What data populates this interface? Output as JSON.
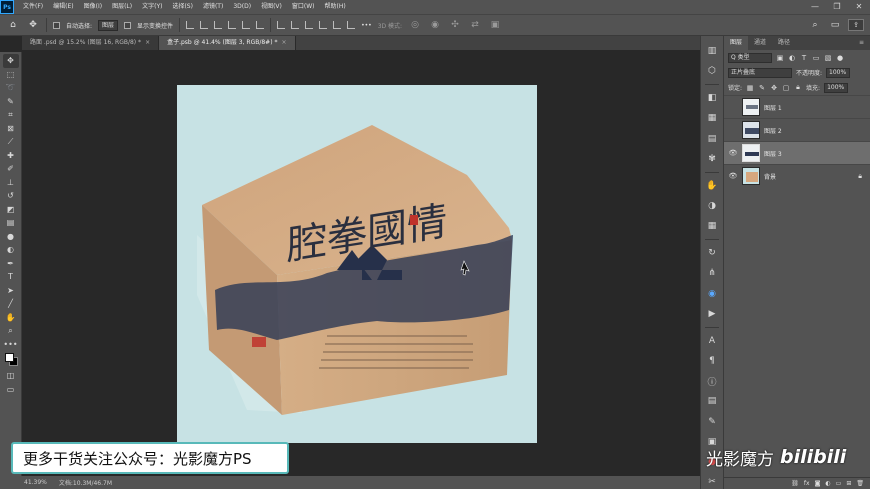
{
  "app": {
    "logo": "Ps"
  },
  "menubar": {
    "items": [
      "文件(F)",
      "编辑(E)",
      "图像(I)",
      "图层(L)",
      "文字(Y)",
      "选择(S)",
      "滤镜(T)",
      "3D(D)",
      "视图(V)",
      "窗口(W)",
      "帮助(H)"
    ],
    "window_controls": [
      "—",
      "❐",
      "✕"
    ]
  },
  "optionsbar": {
    "auto_select_label": "自动选择:",
    "auto_select_value": "图层",
    "show_transform_label": "显示变换控件",
    "more": "•••",
    "mode_3d_label": "3D 模式:"
  },
  "tabs": [
    {
      "label": "路面 .psd @ 15.2% (图层 16, RGB/8) *",
      "close": "×",
      "active": false
    },
    {
      "label": "盒子.psb @ 41.4% (图层 3, RGB/8#) *",
      "close": "×",
      "active": true
    }
  ],
  "toolbox": {
    "tools": [
      "move-tool",
      "marquee-tool",
      "lasso-tool",
      "quick-select-tool",
      "crop-tool",
      "frame-tool",
      "eyedropper-tool",
      "healing-tool",
      "brush-tool",
      "stamp-tool",
      "history-brush-tool",
      "eraser-tool",
      "gradient-tool",
      "blur-tool",
      "dodge-tool",
      "pen-tool",
      "type-tool",
      "path-select-tool",
      "shape-tool",
      "hand-tool",
      "zoom-tool",
      "edit-toolbar"
    ]
  },
  "artwork": {
    "box_title_chars": "腔拳國情",
    "colors": {
      "background": "#c7e2e4",
      "box": "#d6b08c",
      "ink": "#2f3a55",
      "stamp": "#c0332b"
    }
  },
  "statusbar": {
    "zoom": "41.39%",
    "doc_info": "文档:10.3M/46.7M"
  },
  "layers_panel": {
    "tabs": [
      "图层",
      "通道",
      "路径"
    ],
    "filter_label": "Q 类型",
    "blend_mode": "正片叠底",
    "opacity_label": "不透明度:",
    "opacity_value": "100%",
    "lock_label": "锁定:",
    "fill_label": "填充:",
    "fill_value": "100%",
    "layers": [
      {
        "name": "图层 1",
        "visible": false,
        "selected": false,
        "locked": false
      },
      {
        "name": "图层 2",
        "visible": false,
        "selected": false,
        "locked": false
      },
      {
        "name": "图层 3",
        "visible": true,
        "selected": true,
        "locked": false
      },
      {
        "name": "背景",
        "visible": true,
        "selected": false,
        "locked": true
      }
    ],
    "footer_icons": [
      "link-icon",
      "fx-icon",
      "mask-icon",
      "adjustment-icon",
      "group-icon",
      "new-layer-icon",
      "trash-icon"
    ],
    "footer_fx": "fx"
  },
  "overlays": {
    "promo_banner": "更多干货关注公众号：光影魔方PS",
    "watermark_text": "光影魔方",
    "watermark_logo": "bilibili"
  }
}
